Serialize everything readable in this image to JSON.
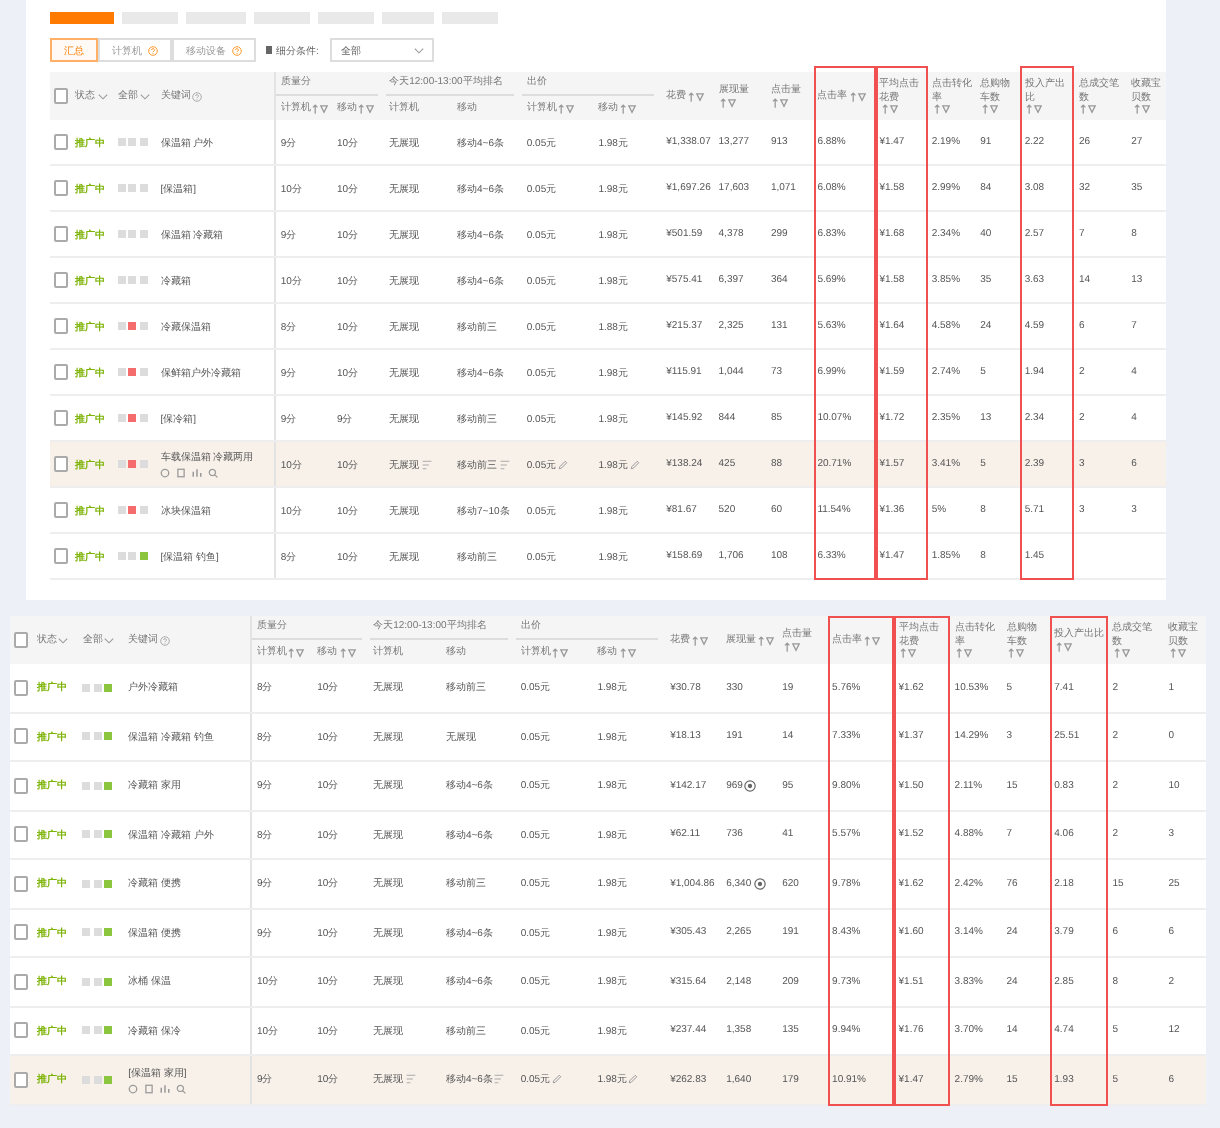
{
  "top_tabs": [
    {
      "selected": true
    },
    {
      "selected": false
    },
    {
      "selected": false
    },
    {
      "selected": false
    },
    {
      "selected": false
    },
    {
      "selected": false
    },
    {
      "selected": false
    }
  ],
  "filters": {
    "segments": [
      {
        "label": "汇总",
        "selected": true,
        "help": false
      },
      {
        "label": "计算机",
        "selected": false,
        "help": true
      },
      {
        "label": "移动设备",
        "selected": false,
        "help": true
      }
    ],
    "condition_label": "细分条件:",
    "condition_select": {
      "value": "全部"
    }
  },
  "panels": [
    {
      "select_all_checked": false,
      "columns": {
        "leading": [
          {
            "label": "状态",
            "kind": "dropdown"
          },
          {
            "label": "全部",
            "kind": "dropdown"
          },
          {
            "label": "关键词",
            "kind": "help"
          }
        ],
        "groups": [
          {
            "label": "质量分",
            "columns": [
              {
                "label": "计算机",
                "sortable": true
              },
              {
                "label": "移动",
                "sortable": true
              }
            ]
          },
          {
            "label": "今天12:00-13:00平均排名",
            "columns": [
              {
                "label": "计算机",
                "sortable": false
              },
              {
                "label": "移动",
                "sortable": false
              }
            ]
          },
          {
            "label": "出价",
            "columns": [
              {
                "label": "计算机",
                "sortable": true
              },
              {
                "label": "移动",
                "sortable": true
              }
            ]
          }
        ],
        "metrics": [
          {
            "label": "花费",
            "sortable": true,
            "highlighted": false
          },
          {
            "label": "展现量",
            "sortable": true,
            "highlighted": false
          },
          {
            "label": "点击量",
            "sortable": true,
            "highlighted": false
          },
          {
            "label": "点击率",
            "sortable": true,
            "highlighted": true
          },
          {
            "label": "平均点击花费",
            "sortable": true,
            "highlighted": true
          },
          {
            "label": "点击转化率",
            "sortable": true,
            "highlighted": false
          },
          {
            "label": "总购物车数",
            "sortable": true,
            "highlighted": false
          },
          {
            "label": "投入产出比",
            "sortable": true,
            "highlighted": true
          },
          {
            "label": "总成交笔数",
            "sortable": true,
            "highlighted": false
          },
          {
            "label": "收藏宝贝数",
            "sortable": true,
            "highlighted": false
          }
        ]
      },
      "rows": [
        {
          "checked": false,
          "status": "推广中",
          "marks": [
            {
              "color": "#dcdcdc"
            },
            {
              "color": "#dcdcdc"
            },
            {
              "color": "#dcdcdc"
            }
          ],
          "keyword": "保温箱 户外",
          "highlighted": false,
          "flagged": false,
          "values": [
            "9分",
            "10分",
            "无展现",
            "移动4~6条",
            "0.05元",
            "1.98元",
            "¥1,338.07",
            "13,277",
            "913",
            "6.88%",
            "¥1.47",
            "2.19%",
            "91",
            "2.22",
            "26",
            "27"
          ]
        },
        {
          "checked": false,
          "status": "推广中",
          "marks": [
            {
              "color": "#dcdcdc"
            },
            {
              "color": "#dcdcdc"
            },
            {
              "color": "#dcdcdc"
            }
          ],
          "keyword": "[保温箱]",
          "highlighted": false,
          "flagged": false,
          "values": [
            "10分",
            "10分",
            "无展现",
            "移动4~6条",
            "0.05元",
            "1.98元",
            "¥1,697.26",
            "17,603",
            "1,071",
            "6.08%",
            "¥1.58",
            "2.99%",
            "84",
            "3.08",
            "32",
            "35"
          ]
        },
        {
          "checked": false,
          "status": "推广中",
          "marks": [
            {
              "color": "#dcdcdc"
            },
            {
              "color": "#dcdcdc"
            },
            {
              "color": "#dcdcdc"
            }
          ],
          "keyword": "保温箱 冷藏箱",
          "highlighted": false,
          "flagged": false,
          "values": [
            "9分",
            "10分",
            "无展现",
            "移动4~6条",
            "0.05元",
            "1.98元",
            "¥501.59",
            "4,378",
            "299",
            "6.83%",
            "¥1.68",
            "2.34%",
            "40",
            "2.57",
            "7",
            "8"
          ]
        },
        {
          "checked": false,
          "status": "推广中",
          "marks": [
            {
              "color": "#dcdcdc"
            },
            {
              "color": "#dcdcdc"
            },
            {
              "color": "#dcdcdc"
            }
          ],
          "keyword": "冷藏箱",
          "highlighted": false,
          "flagged": false,
          "values": [
            "10分",
            "10分",
            "无展现",
            "移动4~6条",
            "0.05元",
            "1.98元",
            "¥575.41",
            "6,397",
            "364",
            "5.69%",
            "¥1.58",
            "3.85%",
            "35",
            "3.63",
            "14",
            "13"
          ]
        },
        {
          "checked": false,
          "status": "推广中",
          "marks": [
            {
              "color": "#dcdcdc"
            },
            {
              "color": "#f56c6c"
            },
            {
              "color": "#dcdcdc"
            }
          ],
          "keyword": "冷藏保温箱",
          "highlighted": false,
          "flagged": false,
          "values": [
            "8分",
            "10分",
            "无展现",
            "移动前三",
            "0.05元",
            "1.88元",
            "¥215.37",
            "2,325",
            "131",
            "5.63%",
            "¥1.64",
            "4.58%",
            "24",
            "4.59",
            "6",
            "7"
          ]
        },
        {
          "checked": false,
          "status": "推广中",
          "marks": [
            {
              "color": "#dcdcdc"
            },
            {
              "color": "#f56c6c"
            },
            {
              "color": "#dcdcdc"
            }
          ],
          "keyword": "保鲜箱户外冷藏箱",
          "highlighted": false,
          "flagged": false,
          "values": [
            "9分",
            "10分",
            "无展现",
            "移动4~6条",
            "0.05元",
            "1.98元",
            "¥115.91",
            "1,044",
            "73",
            "6.99%",
            "¥1.59",
            "2.74%",
            "5",
            "1.94",
            "2",
            "4"
          ]
        },
        {
          "checked": false,
          "status": "推广中",
          "marks": [
            {
              "color": "#dcdcdc"
            },
            {
              "color": "#f56c6c"
            },
            {
              "color": "#dcdcdc"
            }
          ],
          "keyword": "[保冷箱]",
          "highlighted": false,
          "flagged": false,
          "values": [
            "9分",
            "9分",
            "无展现",
            "移动前三",
            "0.05元",
            "1.98元",
            "¥145.92",
            "844",
            "85",
            "10.07%",
            "¥1.72",
            "2.35%",
            "13",
            "2.34",
            "2",
            "4"
          ]
        },
        {
          "checked": false,
          "status": "推广中",
          "marks": [
            {
              "color": "#dcdcdc"
            },
            {
              "color": "#f56c6c"
            },
            {
              "color": "#dcdcdc"
            }
          ],
          "keyword": "车载保温箱 冷藏两用",
          "highlighted": true,
          "flagged": false,
          "values": [
            "10分",
            "10分",
            "无展现",
            "移动前三",
            "0.05元",
            "1.98元",
            "¥138.24",
            "425",
            "88",
            "20.71%",
            "¥1.57",
            "3.41%",
            "5",
            "2.39",
            "3",
            "6"
          ]
        },
        {
          "checked": false,
          "status": "推广中",
          "marks": [
            {
              "color": "#dcdcdc"
            },
            {
              "color": "#f56c6c"
            },
            {
              "color": "#dcdcdc"
            }
          ],
          "keyword": "冰块保温箱",
          "highlighted": false,
          "flagged": false,
          "values": [
            "10分",
            "10分",
            "无展现",
            "移动7~10条",
            "0.05元",
            "1.98元",
            "¥81.67",
            "520",
            "60",
            "11.54%",
            "¥1.36",
            "5%",
            "8",
            "5.71",
            "3",
            "3"
          ]
        },
        {
          "checked": false,
          "status": "推广中",
          "marks": [
            {
              "color": "#dcdcdc"
            },
            {
              "color": "#dcdcdc"
            },
            {
              "color": "#8cc63f"
            }
          ],
          "keyword": "[保温箱 钓鱼]",
          "highlighted": false,
          "flagged": false,
          "values": [
            "8分",
            "10分",
            "无展现",
            "移动前三",
            "0.05元",
            "1.98元",
            "¥158.69",
            "1,706",
            "108",
            "6.33%",
            "¥1.47",
            "1.85%",
            "8",
            "1.45"
          ]
        }
      ]
    },
    {
      "select_all_checked": false,
      "columns": {
        "leading": [
          {
            "label": "状态",
            "kind": "dropdown"
          },
          {
            "label": "全部",
            "kind": "dropdown"
          },
          {
            "label": "关键词",
            "kind": "help"
          }
        ],
        "groups": [
          {
            "label": "质量分",
            "columns": [
              {
                "label": "计算机",
                "sortable": true
              },
              {
                "label": "移动",
                "sortable": true
              }
            ]
          },
          {
            "label": "今天12:00-13:00平均排名",
            "columns": [
              {
                "label": "计算机",
                "sortable": false
              },
              {
                "label": "移动",
                "sortable": false
              }
            ]
          },
          {
            "label": "出价",
            "columns": [
              {
                "label": "计算机",
                "sortable": true
              },
              {
                "label": "移动",
                "sortable": true
              }
            ]
          }
        ],
        "metrics": [
          {
            "label": "花费",
            "sortable": true,
            "highlighted": false
          },
          {
            "label": "展现量",
            "sortable": true,
            "highlighted": false
          },
          {
            "label": "点击量",
            "sortable": true,
            "highlighted": false
          },
          {
            "label": "点击率",
            "sortable": true,
            "highlighted": true
          },
          {
            "label": "平均点击花费",
            "sortable": true,
            "highlighted": true
          },
          {
            "label": "点击转化率",
            "sortable": true,
            "highlighted": false
          },
          {
            "label": "总购物车数",
            "sortable": true,
            "highlighted": false
          },
          {
            "label": "投入产出比",
            "sortable": true,
            "highlighted": true
          },
          {
            "label": "总成交笔数",
            "sortable": true,
            "highlighted": false
          },
          {
            "label": "收藏宝贝数",
            "sortable": true,
            "highlighted": false
          }
        ]
      },
      "rows": [
        {
          "checked": false,
          "status": "推广中",
          "marks": [
            {
              "color": "#dcdcdc"
            },
            {
              "color": "#dcdcdc"
            },
            {
              "color": "#8cc63f"
            }
          ],
          "keyword": "户外冷藏箱",
          "highlighted": false,
          "flagged": false,
          "values": [
            "8分",
            "10分",
            "无展现",
            "移动前三",
            "0.05元",
            "1.98元",
            "¥30.78",
            "330",
            "19",
            "5.76%",
            "¥1.62",
            "10.53%",
            "5",
            "7.41",
            "2",
            "1"
          ]
        },
        {
          "checked": false,
          "status": "推广中",
          "marks": [
            {
              "color": "#dcdcdc"
            },
            {
              "color": "#dcdcdc"
            },
            {
              "color": "#8cc63f"
            }
          ],
          "keyword": "保温箱 冷藏箱 钓鱼",
          "highlighted": false,
          "flagged": false,
          "values": [
            "8分",
            "10分",
            "无展现",
            "无展现",
            "0.05元",
            "1.98元",
            "¥18.13",
            "191",
            "14",
            "7.33%",
            "¥1.37",
            "14.29%",
            "3",
            "25.51",
            "2",
            "0"
          ]
        },
        {
          "checked": false,
          "status": "推广中",
          "marks": [
            {
              "color": "#dcdcdc"
            },
            {
              "color": "#dcdcdc"
            },
            {
              "color": "#8cc63f"
            }
          ],
          "keyword": "冷藏箱 家用",
          "highlighted": false,
          "flagged": true,
          "values": [
            "9分",
            "10分",
            "无展现",
            "移动4~6条",
            "0.05元",
            "1.98元",
            "¥142.17",
            "969",
            "95",
            "9.80%",
            "¥1.50",
            "2.11%",
            "15",
            "0.83",
            "2",
            "10"
          ]
        },
        {
          "checked": false,
          "status": "推广中",
          "marks": [
            {
              "color": "#dcdcdc"
            },
            {
              "color": "#dcdcdc"
            },
            {
              "color": "#8cc63f"
            }
          ],
          "keyword": "保温箱 冷藏箱 户外",
          "highlighted": false,
          "flagged": false,
          "values": [
            "8分",
            "10分",
            "无展现",
            "移动4~6条",
            "0.05元",
            "1.98元",
            "¥62.11",
            "736",
            "41",
            "5.57%",
            "¥1.52",
            "4.88%",
            "7",
            "4.06",
            "2",
            "3"
          ]
        },
        {
          "checked": false,
          "status": "推广中",
          "marks": [
            {
              "color": "#dcdcdc"
            },
            {
              "color": "#dcdcdc"
            },
            {
              "color": "#8cc63f"
            }
          ],
          "keyword": "冷藏箱 便携",
          "highlighted": false,
          "flagged": true,
          "values": [
            "9分",
            "10分",
            "无展现",
            "移动前三",
            "0.05元",
            "1.98元",
            "¥1,004.86",
            "6,340",
            "620",
            "9.78%",
            "¥1.62",
            "2.42%",
            "76",
            "2.18",
            "15",
            "25"
          ]
        },
        {
          "checked": false,
          "status": "推广中",
          "marks": [
            {
              "color": "#dcdcdc"
            },
            {
              "color": "#dcdcdc"
            },
            {
              "color": "#8cc63f"
            }
          ],
          "keyword": "保温箱 便携",
          "highlighted": false,
          "flagged": false,
          "values": [
            "9分",
            "10分",
            "无展现",
            "移动4~6条",
            "0.05元",
            "1.98元",
            "¥305.43",
            "2,265",
            "191",
            "8.43%",
            "¥1.60",
            "3.14%",
            "24",
            "3.79",
            "6",
            "6"
          ]
        },
        {
          "checked": false,
          "status": "推广中",
          "marks": [
            {
              "color": "#dcdcdc"
            },
            {
              "color": "#dcdcdc"
            },
            {
              "color": "#8cc63f"
            }
          ],
          "keyword": "冰桶 保温",
          "highlighted": false,
          "flagged": false,
          "values": [
            "10分",
            "10分",
            "无展现",
            "移动4~6条",
            "0.05元",
            "1.98元",
            "¥315.64",
            "2,148",
            "209",
            "9.73%",
            "¥1.51",
            "3.83%",
            "24",
            "2.85",
            "8",
            "2"
          ]
        },
        {
          "checked": false,
          "status": "推广中",
          "marks": [
            {
              "color": "#dcdcdc"
            },
            {
              "color": "#dcdcdc"
            },
            {
              "color": "#8cc63f"
            }
          ],
          "keyword": "冷藏箱 保冷",
          "highlighted": false,
          "flagged": false,
          "values": [
            "10分",
            "10分",
            "无展现",
            "移动前三",
            "0.05元",
            "1.98元",
            "¥237.44",
            "1,358",
            "135",
            "9.94%",
            "¥1.76",
            "3.70%",
            "14",
            "4.74",
            "5",
            "12"
          ]
        },
        {
          "checked": false,
          "status": "推广中",
          "marks": [
            {
              "color": "#dcdcdc"
            },
            {
              "color": "#dcdcdc"
            },
            {
              "color": "#8cc63f"
            }
          ],
          "keyword": "[保温箱 家用]",
          "highlighted": true,
          "flagged": false,
          "values": [
            "9分",
            "10分",
            "无展现",
            "移动4~6条",
            "0.05元",
            "1.98元",
            "¥262.83",
            "1,640",
            "179",
            "10.91%",
            "¥1.47",
            "2.79%",
            "15",
            "1.93",
            "5",
            "6"
          ]
        }
      ]
    }
  ]
}
